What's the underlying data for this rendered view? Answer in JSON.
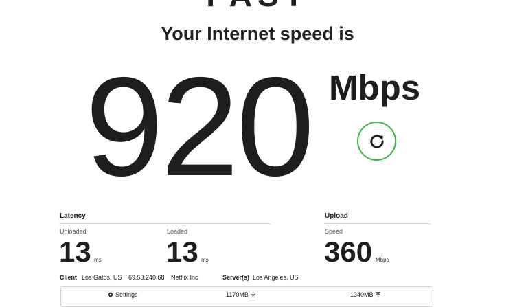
{
  "logo": "FAST",
  "heading": "Your Internet speed is",
  "download": {
    "value": "920",
    "unit": "Mbps"
  },
  "refresh_icon": "refresh-icon",
  "latency": {
    "title": "Latency",
    "unloaded": {
      "label": "Unloaded",
      "value": "13",
      "unit": "ms"
    },
    "loaded": {
      "label": "Loaded",
      "value": "13",
      "unit": "ms"
    }
  },
  "upload": {
    "title": "Upload",
    "speed_label": "Speed",
    "value": "360",
    "unit": "Mbps"
  },
  "info": {
    "client_label": "Client",
    "client_location": "Los Gatos, US",
    "client_ip": "69.53.240.68",
    "client_isp": "Netflix Inc",
    "servers_label": "Server(s)",
    "servers_location": "Los Angeles, US"
  },
  "bottom_bar": {
    "settings_label": "Settings",
    "downloaded": "1170MB",
    "uploaded": "1340MB"
  },
  "colors": {
    "accent_green": "#3ab54a",
    "text": "#1e1e1e"
  }
}
